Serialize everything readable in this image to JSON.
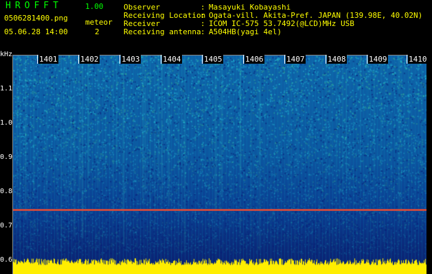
{
  "header": {
    "app_title": "HROFFT",
    "version": "1.00",
    "file_name": "0506281400.png",
    "datetime": "05.06.28 14:00",
    "meteor_label": "meteor",
    "meteor_count": "2"
  },
  "info": [
    {
      "label": "Observer",
      "value": "Masayuki Kobayashi"
    },
    {
      "label": "Receiving Location",
      "value": "Ogata-vill. Akita-Pref. JAPAN (139.98E, 40.02N)"
    },
    {
      "label": "Receiver",
      "value": "ICOM IC-575 53.7492(@LCD)MHz USB"
    },
    {
      "label": "Receiving antenna",
      "value": "A504HB(yagi 4el)"
    }
  ],
  "separator": ":",
  "time_axis": [
    "1401",
    "1402",
    "1403",
    "1404",
    "1405",
    "1406",
    "1407",
    "1408",
    "1409",
    "1410"
  ],
  "freq_axis": {
    "unit": "kHz",
    "labels": [
      "1.1",
      "1.0",
      "0.9",
      "0.8",
      "0.7",
      "0.6"
    ]
  },
  "colors": {
    "background": "#000000",
    "text_yellow": "#ffff00",
    "title_green": "#00ff00",
    "signal_red": "#d84a3a",
    "noise_yellow": "#ffee00"
  }
}
